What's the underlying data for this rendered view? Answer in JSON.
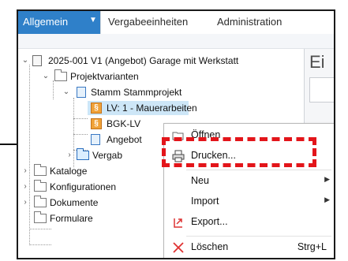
{
  "tabs": [
    {
      "label": "Allgemein",
      "active": true
    },
    {
      "label": "Vergabeeinheiten",
      "active": false
    },
    {
      "label": "Administration",
      "active": false
    }
  ],
  "right_pane": {
    "title": "Ei"
  },
  "tree": {
    "project": "2025-001 V1 (Angebot) Garage mit Werkstatt",
    "variants": "Projektvarianten",
    "master": "Stamm Stammprojekt",
    "lv1": "LV: 1 - Mauerarbeiten",
    "bgk": "BGK-LV",
    "angebot": "Angebot",
    "vergabe": "Vergab",
    "kataloge": "Kataloge",
    "konfigurationen": "Konfigurationen",
    "dokumente": "Dokumente",
    "formulare": "Formulare",
    "lv_icon_text": "§"
  },
  "context_menu": {
    "open": "Öffnen",
    "print": "Drucken...",
    "new": "Neu",
    "import": "Import",
    "export": "Export...",
    "delete": "Löschen",
    "delete_shortcut": "Strg+L"
  },
  "colors": {
    "accent": "#2f80c9",
    "highlight": "#cde6f7",
    "annotation_red": "#e3151a"
  }
}
